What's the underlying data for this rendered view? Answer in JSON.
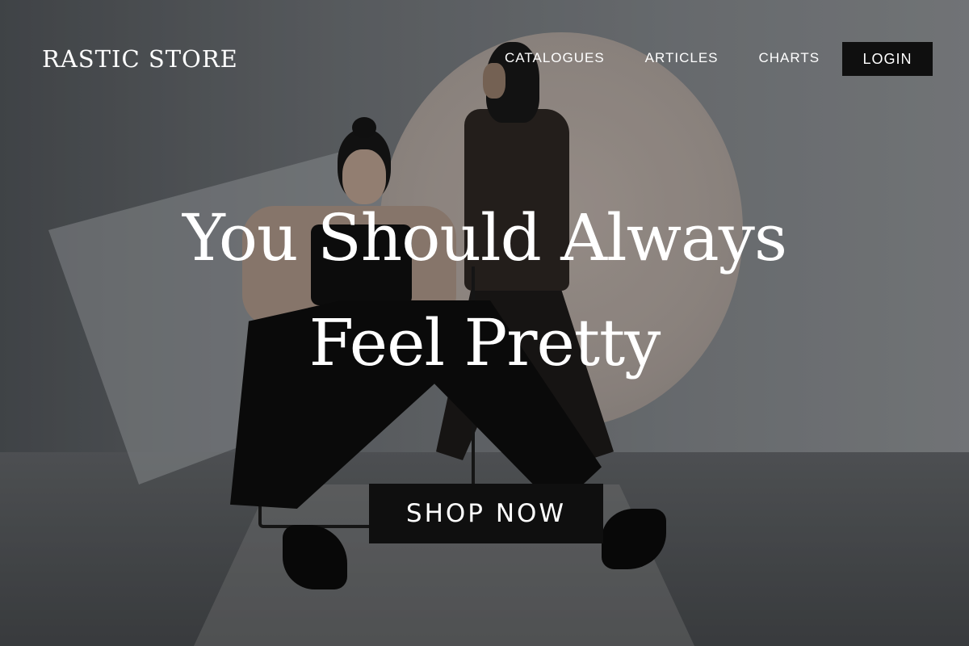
{
  "brand": {
    "logo_text": "RASTIC STORE"
  },
  "nav": {
    "items": [
      {
        "label": "CATALOGUES"
      },
      {
        "label": "ARTICLES"
      },
      {
        "label": "CHARTS"
      }
    ],
    "login_label": "LOGIN"
  },
  "hero": {
    "headline_line1": "You Should Always",
    "headline_line2": "Feel Pretty",
    "cta_label": "SHOP NOW"
  },
  "colors": {
    "button_bg": "#0f0f0f",
    "text": "#ffffff",
    "accent_circle": "#b5aaa3"
  }
}
